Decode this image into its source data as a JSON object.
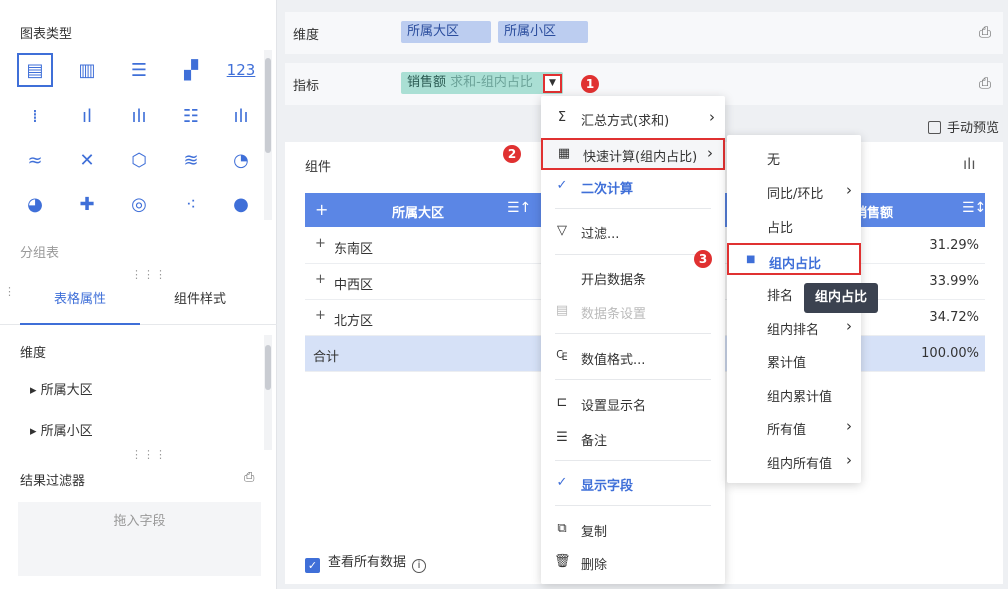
{
  "chart_types": {
    "title": "图表类型"
  },
  "group_table": "分组表",
  "tabs": {
    "table_props": "表格属性",
    "component_style": "组件样式"
  },
  "props": {
    "dimension_label": "维度",
    "items": [
      "所属大区",
      "所属小区"
    ]
  },
  "result_filter": {
    "title": "结果过滤器",
    "drop_hint": "拖入字段"
  },
  "top": {
    "dimension_label": "维度",
    "dimensions": [
      "所属大区",
      "所属小区"
    ],
    "indicator_label": "指标",
    "indicator": {
      "name": "销售额",
      "sub": "求和-组内占比"
    },
    "manual_preview": "手动预览"
  },
  "component": {
    "title": "组件"
  },
  "table": {
    "headers": {
      "plus": "+",
      "region": "所属大区",
      "sales": "销售额"
    },
    "rows": [
      {
        "name": "东南区",
        "value": "31.29%"
      },
      {
        "name": "中西区",
        "value": "33.99%"
      },
      {
        "name": "北方区",
        "value": "34.72%"
      }
    ],
    "total": {
      "label": "合计",
      "value": "100.00%"
    }
  },
  "view_all": "查看所有数据",
  "menu": {
    "summary": "汇总方式(求和)",
    "quick_calc": "快速计算(组内占比)",
    "second_calc": "二次计算",
    "filter": "过滤...",
    "data_bar_on": "开启数据条",
    "data_bar_settings": "数据条设置",
    "number_format": "数值格式...",
    "display_name": "设置显示名",
    "note": "备注",
    "show_field": "显示字段",
    "copy": "复制",
    "delete": "删除"
  },
  "submenu": {
    "items": [
      "无",
      "同比/环比",
      "占比",
      "组内占比",
      "排名",
      "组内排名",
      "累计值",
      "组内累计值",
      "所有值",
      "组内所有值"
    ]
  },
  "tooltip": "组内占比",
  "badges": [
    "1",
    "2",
    "3"
  ],
  "colors": {
    "accent": "#3f6fd8",
    "highlight": "#e03131",
    "header": "#5b86e5"
  }
}
